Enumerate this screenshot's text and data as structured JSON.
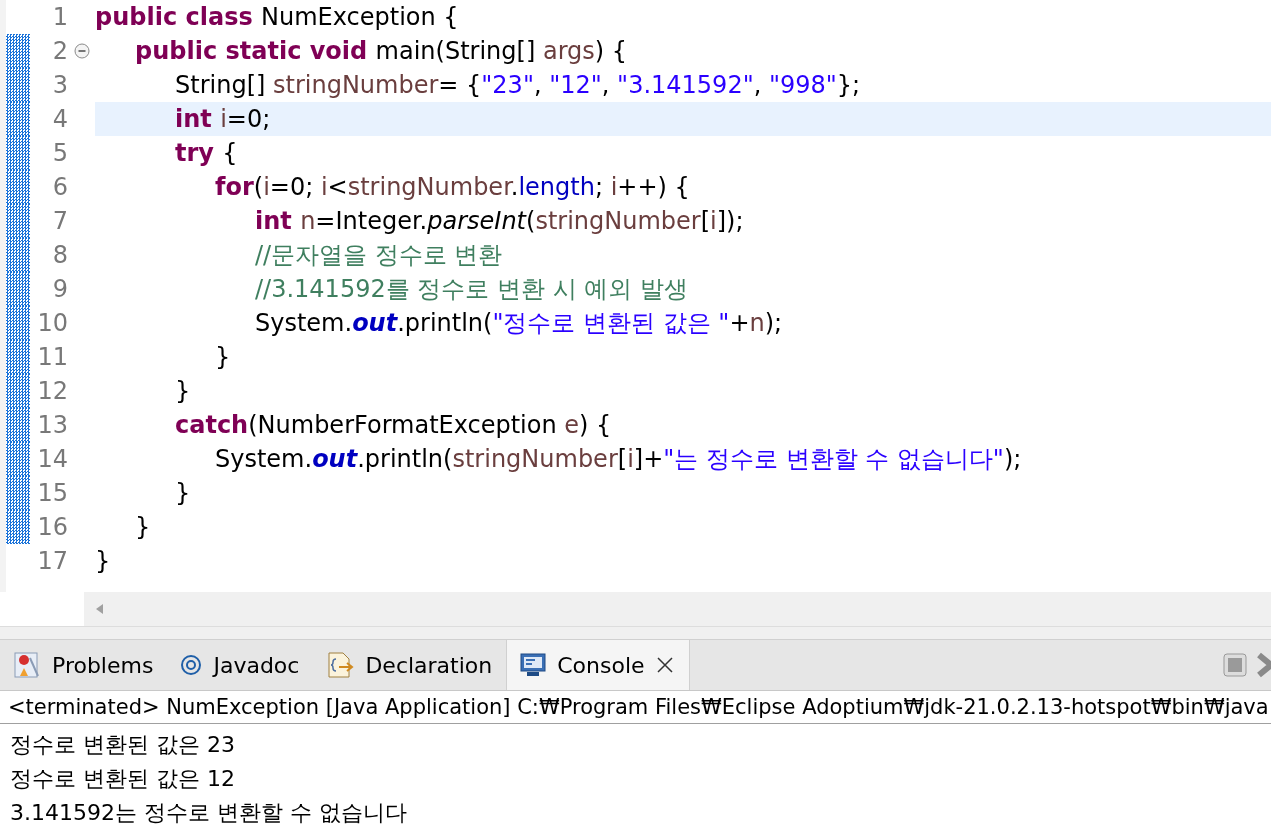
{
  "editor": {
    "lines": [
      {
        "number": "1",
        "current": false,
        "changed": false,
        "fold": false,
        "tokens": [
          {
            "kind": "keyword",
            "text": "public class "
          },
          {
            "kind": "plain",
            "text": "NumException {"
          }
        ],
        "children": [
          {
            "number": "2",
            "current": false,
            "changed": true,
            "fold": true,
            "tokens": [
              {
                "kind": "keyword",
                "text": "public static void "
              },
              {
                "kind": "plain",
                "text": "main(String[] "
              },
              {
                "kind": "variable",
                "text": "args"
              },
              {
                "kind": "plain",
                "text": ") {"
              }
            ],
            "children": [
              {
                "number": "3",
                "current": false,
                "changed": true,
                "fold": false,
                "tokens": [
                  {
                    "kind": "plain",
                    "text": "String[] "
                  },
                  {
                    "kind": "variable",
                    "text": "stringNumber"
                  },
                  {
                    "kind": "plain",
                    "text": "= {"
                  },
                  {
                    "kind": "string",
                    "text": "\"23\""
                  },
                  {
                    "kind": "plain",
                    "text": ", "
                  },
                  {
                    "kind": "string",
                    "text": "\"12\""
                  },
                  {
                    "kind": "plain",
                    "text": ", "
                  },
                  {
                    "kind": "string",
                    "text": "\"3.141592\""
                  },
                  {
                    "kind": "plain",
                    "text": ", "
                  },
                  {
                    "kind": "string",
                    "text": "\"998\""
                  },
                  {
                    "kind": "plain",
                    "text": "};"
                  }
                ]
              },
              {
                "number": "4",
                "current": true,
                "changed": true,
                "fold": false,
                "tokens": [
                  {
                    "kind": "keyword",
                    "text": "int "
                  },
                  {
                    "kind": "variable",
                    "text": "i"
                  },
                  {
                    "kind": "plain",
                    "text": "=0;"
                  }
                ]
              },
              {
                "number": "5",
                "current": false,
                "changed": true,
                "fold": false,
                "tokens": [
                  {
                    "kind": "keyword",
                    "text": "try "
                  },
                  {
                    "kind": "plain",
                    "text": "{"
                  }
                ],
                "children": [
                  {
                    "number": "6",
                    "current": false,
                    "changed": true,
                    "fold": false,
                    "tokens": [
                      {
                        "kind": "keyword",
                        "text": "for"
                      },
                      {
                        "kind": "plain",
                        "text": "("
                      },
                      {
                        "kind": "variable",
                        "text": "i"
                      },
                      {
                        "kind": "plain",
                        "text": "=0; "
                      },
                      {
                        "kind": "variable",
                        "text": "i"
                      },
                      {
                        "kind": "plain",
                        "text": "<"
                      },
                      {
                        "kind": "variable",
                        "text": "stringNumber"
                      },
                      {
                        "kind": "plain",
                        "text": "."
                      },
                      {
                        "kind": "field",
                        "text": "length"
                      },
                      {
                        "kind": "plain",
                        "text": "; "
                      },
                      {
                        "kind": "variable",
                        "text": "i"
                      },
                      {
                        "kind": "plain",
                        "text": "++) {"
                      }
                    ],
                    "children": [
                      {
                        "number": "7",
                        "current": false,
                        "changed": true,
                        "fold": false,
                        "tokens": [
                          {
                            "kind": "keyword",
                            "text": "int "
                          },
                          {
                            "kind": "variable",
                            "text": "n"
                          },
                          {
                            "kind": "plain",
                            "text": "=Integer."
                          },
                          {
                            "kind": "method",
                            "text": "parseInt"
                          },
                          {
                            "kind": "plain",
                            "text": "("
                          },
                          {
                            "kind": "variable",
                            "text": "stringNumber"
                          },
                          {
                            "kind": "plain",
                            "text": "["
                          },
                          {
                            "kind": "variable",
                            "text": "i"
                          },
                          {
                            "kind": "plain",
                            "text": "]);"
                          }
                        ]
                      },
                      {
                        "number": "8",
                        "current": false,
                        "changed": true,
                        "fold": false,
                        "tokens": [
                          {
                            "kind": "comment",
                            "text": "//문자열을 정수로 변환"
                          }
                        ]
                      },
                      {
                        "number": "9",
                        "current": false,
                        "changed": true,
                        "fold": false,
                        "tokens": [
                          {
                            "kind": "comment",
                            "text": "//3.141592를 정수로 변환 시 예외 발생"
                          }
                        ]
                      },
                      {
                        "number": "10",
                        "current": false,
                        "changed": true,
                        "fold": false,
                        "tokens": [
                          {
                            "kind": "plain",
                            "text": "System."
                          },
                          {
                            "kind": "static",
                            "text": "out"
                          },
                          {
                            "kind": "plain",
                            "text": ".println("
                          },
                          {
                            "kind": "string",
                            "text": "\"정수로 변환된 값은 \""
                          },
                          {
                            "kind": "plain",
                            "text": "+"
                          },
                          {
                            "kind": "variable",
                            "text": "n"
                          },
                          {
                            "kind": "plain",
                            "text": ");"
                          }
                        ]
                      }
                    ]
                  },
                  {
                    "number": "11",
                    "current": false,
                    "changed": true,
                    "fold": false,
                    "tokens": [
                      {
                        "kind": "plain",
                        "text": "}"
                      }
                    ]
                  }
                ]
              },
              {
                "number": "12",
                "current": false,
                "changed": true,
                "fold": false,
                "tokens": [
                  {
                    "kind": "plain",
                    "text": "}"
                  }
                ]
              },
              {
                "number": "13",
                "current": false,
                "changed": true,
                "fold": false,
                "tokens": [
                  {
                    "kind": "keyword",
                    "text": "catch"
                  },
                  {
                    "kind": "plain",
                    "text": "(NumberFormatException "
                  },
                  {
                    "kind": "variable",
                    "text": "e"
                  },
                  {
                    "kind": "plain",
                    "text": ") {"
                  }
                ],
                "children": [
                  {
                    "number": "14",
                    "current": false,
                    "changed": true,
                    "fold": false,
                    "tokens": [
                      {
                        "kind": "plain",
                        "text": "System."
                      },
                      {
                        "kind": "static",
                        "text": "out"
                      },
                      {
                        "kind": "plain",
                        "text": ".println("
                      },
                      {
                        "kind": "variable",
                        "text": "stringNumber"
                      },
                      {
                        "kind": "plain",
                        "text": "["
                      },
                      {
                        "kind": "variable",
                        "text": "i"
                      },
                      {
                        "kind": "plain",
                        "text": "]+"
                      },
                      {
                        "kind": "string",
                        "text": "\"는 정수로 변환할 수 없습니다\""
                      },
                      {
                        "kind": "plain",
                        "text": ");"
                      }
                    ]
                  }
                ]
              },
              {
                "number": "15",
                "current": false,
                "changed": true,
                "fold": false,
                "tokens": [
                  {
                    "kind": "plain",
                    "text": "}"
                  }
                ]
              }
            ]
          },
          {
            "number": "16",
            "current": false,
            "changed": true,
            "fold": false,
            "tokens": [
              {
                "kind": "plain",
                "text": "}"
              }
            ]
          }
        ]
      },
      {
        "number": "17",
        "current": false,
        "changed": false,
        "fold": false,
        "tokens": [
          {
            "kind": "plain",
            "text": "}"
          }
        ]
      }
    ]
  },
  "panel": {
    "tabs": [
      {
        "label": "Problems",
        "selected": false,
        "closable": false
      },
      {
        "label": "Javadoc",
        "selected": false,
        "closable": false
      },
      {
        "label": "Declaration",
        "selected": false,
        "closable": false
      },
      {
        "label": "Console",
        "selected": true,
        "closable": true
      }
    ],
    "console_header": "<terminated> NumException [Java Application] C:₩Program Files₩Eclipse Adoptium₩jdk-21.0.2.13-hotspot₩bin₩java",
    "output": [
      "정수로 변환된 값은 23",
      "정수로 변환된 값은 12",
      "3.141592는 정수로 변환할 수 없습니다"
    ]
  }
}
